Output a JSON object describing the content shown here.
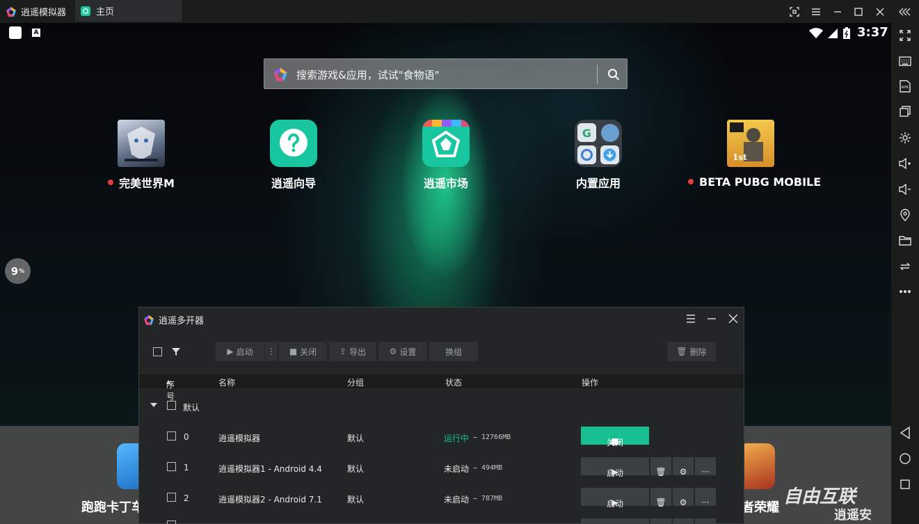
{
  "window": {
    "app_title": "逍遥模拟器",
    "tab_label": "主页"
  },
  "status_bar": {
    "time": "3:37",
    "left_badge": "A"
  },
  "search": {
    "placeholder": "搜索游戏&应用，试试\"食物语\""
  },
  "apps": [
    {
      "label": "完美世界M",
      "dot": true
    },
    {
      "label": "逍遥向导",
      "dot": false
    },
    {
      "label": "逍遥市场",
      "dot": false
    },
    {
      "label": "内置应用",
      "dot": false
    },
    {
      "label": "BETA PUBG MOBILE",
      "dot": true
    }
  ],
  "progress": {
    "value": "9",
    "unit": "%"
  },
  "dock": {
    "left_label": "跑跑卡丁车",
    "right_label": "者荣耀"
  },
  "watermark": {
    "text": "自由互联",
    "sub": "逍遥安"
  },
  "dialog": {
    "title": "逍遥多开器",
    "toolbar": {
      "start": "启动",
      "close": "关闭",
      "export": "导出",
      "settings": "设置",
      "switch_group": "换组",
      "delete": "删除"
    },
    "columns": {
      "index": "序号",
      "name": "名称",
      "group": "分组",
      "status": "状态",
      "action": "操作"
    },
    "group_name": "默认",
    "rows": [
      {
        "index": "0",
        "name": "逍遥模拟器",
        "group": "默认",
        "status": "运行中",
        "ram": "12766MB",
        "running": true,
        "action": "关闭"
      },
      {
        "index": "1",
        "name": "逍遥模拟器1 - Android 4.4",
        "group": "默认",
        "status": "未启动",
        "ram": "494MB",
        "running": false,
        "action": "启动"
      },
      {
        "index": "2",
        "name": "逍遥模拟器2 - Android 7.1",
        "group": "默认",
        "status": "未启动",
        "ram": "787MB",
        "running": false,
        "action": "启动"
      }
    ],
    "colors": {
      "running": "#17bf93",
      "accent": "#17bf93"
    }
  }
}
